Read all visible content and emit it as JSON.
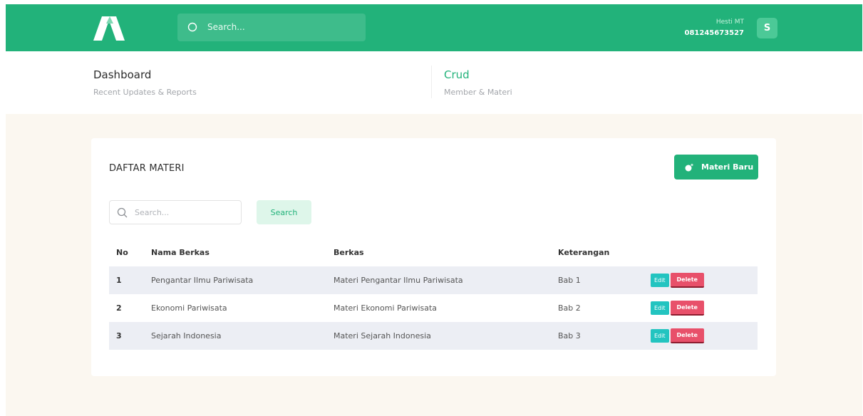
{
  "topbar": {
    "search_placeholder": "Search...",
    "user_name": "Hesti MT",
    "user_phone": "081245673527",
    "avatar_initial": "S"
  },
  "subnav": {
    "dashboard": {
      "title": "Dashboard",
      "subtitle": "Recent Updates & Reports"
    },
    "crud": {
      "title": "Crud",
      "subtitle": "Member & Materi"
    }
  },
  "card": {
    "title": "DAFTAR MATERI",
    "new_button": "Materi Baru",
    "search_placeholder": "Search...",
    "search_button": "Search"
  },
  "table": {
    "headers": [
      "No",
      "Nama Berkas",
      "Berkas",
      "Keterangan"
    ],
    "rows": [
      {
        "no": "1",
        "nama": "Pengantar Ilmu Pariwisata",
        "berkas": "Materi Pengantar Ilmu Pariwisata",
        "ket": "Bab 1"
      },
      {
        "no": "2",
        "nama": "Ekonomi Pariwisata",
        "berkas": "Materi Ekonomi Pariwisata",
        "ket": "Bab 2"
      },
      {
        "no": "3",
        "nama": "Sejarah Indonesia",
        "berkas": "Materi Sejarah Indonesia",
        "ket": "Bab 3"
      }
    ],
    "edit_label": "Edit",
    "delete_label": "Delete"
  },
  "icons": {
    "logo": "logo-icon",
    "search": "search-icon",
    "add": "add-icon"
  },
  "colors": {
    "brand": "#22b27a",
    "edit": "#23c4c0",
    "delete": "#e8506a",
    "background": "#fbf7f0"
  }
}
